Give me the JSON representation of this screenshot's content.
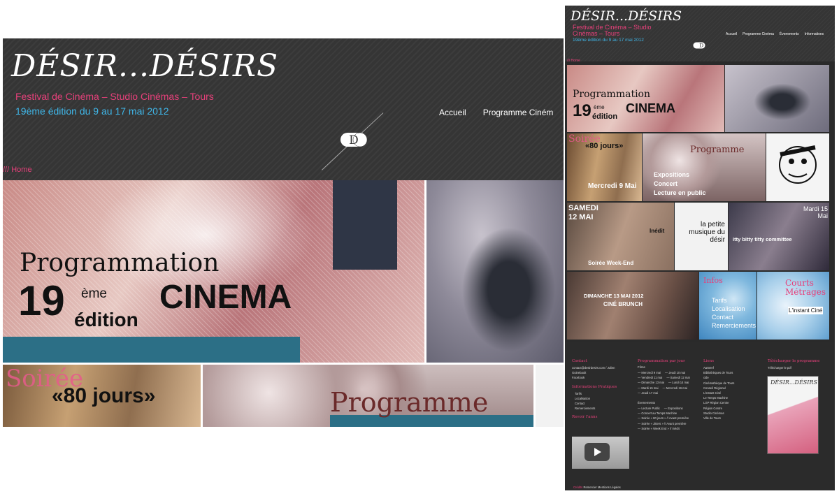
{
  "site": {
    "logo": "DÉSIR...DÉSIRS",
    "subtitle": "Festival de Cinéma – Studio Cinémas – Tours",
    "edition": "19ème édition du 9 au 17 mai 2012",
    "nav": [
      "Accueil",
      "Programme Cinéma",
      "Évenements",
      "Informations"
    ],
    "nav_truncated": "Programme Ciném",
    "breadcrumb": "/// Home"
  },
  "hero": {
    "title": "Programmation",
    "num": "19",
    "sup": "ème",
    "edition": "édition",
    "cinema": "CINEMA"
  },
  "tiles": {
    "soiree": "Soirée",
    "eighty": "«80 jours»",
    "programme": "Programme",
    "expo": "Expositions",
    "concert": "Concert",
    "lecture": "Lecture en public",
    "mercredi": "Mercredi 9 Mai",
    "samedi": "SAMEDI 12 MAI",
    "inedit": "Inédit",
    "weekend": "Soirée Week-End",
    "petite": "la petite musique du désir",
    "mardi": "Mardi 15 Mai",
    "itty": "itty bitty titty committee",
    "dimanche": "DIMANCHE 13 MAI 2012",
    "brunch": "CINÉ BRUNCH",
    "infos": "Infos",
    "tarifs": "Tarifs",
    "localisation": "Localisation",
    "contact": "Contact",
    "remerciements": "Remerciements",
    "courts": "Courts Métrages",
    "instant": "L'instant Ciné"
  },
  "footer": {
    "contact_h": "Contact",
    "contact_items": [
      "contact@desirdesirs.com / Julien",
      "Guinebault",
      "Facebook"
    ],
    "infos_h": "Informations Pratiques",
    "infos_items": [
      "Tarifs",
      "Localisation",
      "Contact",
      "Remerciements"
    ],
    "revoir_h": "Revoir l'anns",
    "prog_h": "Programmation par jour",
    "films_label": "Films",
    "days": [
      [
        "— Mercredi 9 mai",
        "— Jeudi 10 mai"
      ],
      [
        "— Vendredi 11 mai",
        "— Samedi 12 mai"
      ],
      [
        "— Dimanche 13 mai",
        "— Lundi 14 mai"
      ],
      [
        "— Mardi 15 mai",
        "— Mercredi 16 mai"
      ],
      [
        "— Jeudi 17 mai",
        ""
      ]
    ],
    "events_label": "Évenements",
    "events": [
      [
        "— Lecture Public",
        "— Expositions"
      ],
      [
        "— Concert au Temps Machine",
        ""
      ],
      [
        "— Soirée « 80 jours » // Avant première",
        ""
      ],
      [
        "— Soirée « Jitters » // Avant première",
        ""
      ],
      [
        "— Soirée « Week End » // Inédit",
        ""
      ]
    ],
    "liens_h": "Liens",
    "liens": [
      "Aarteref",
      "Bibliothèques de Tours",
      "cide",
      "Cinémathèque de Tours",
      "Conseil Régional",
      "L'instant Ciné",
      "Le Temps Machine",
      "LGP Région Centre",
      "Région Centre",
      "Studio Cinémas",
      "Ville de Tours"
    ],
    "dl_h": "Télécharger le programme",
    "dl_link": "Télécharger le pdf",
    "poster_text": "DÉSIR...DÉSIRS",
    "bottom_pink": "Crédits",
    "bottom_rest": "Remercier   Mentions Légales"
  },
  "colors": {
    "accent_pink": "#e6407a",
    "accent_blue": "#3fb6e8",
    "header_bg": "#353535",
    "teal": "#2c6f86"
  }
}
